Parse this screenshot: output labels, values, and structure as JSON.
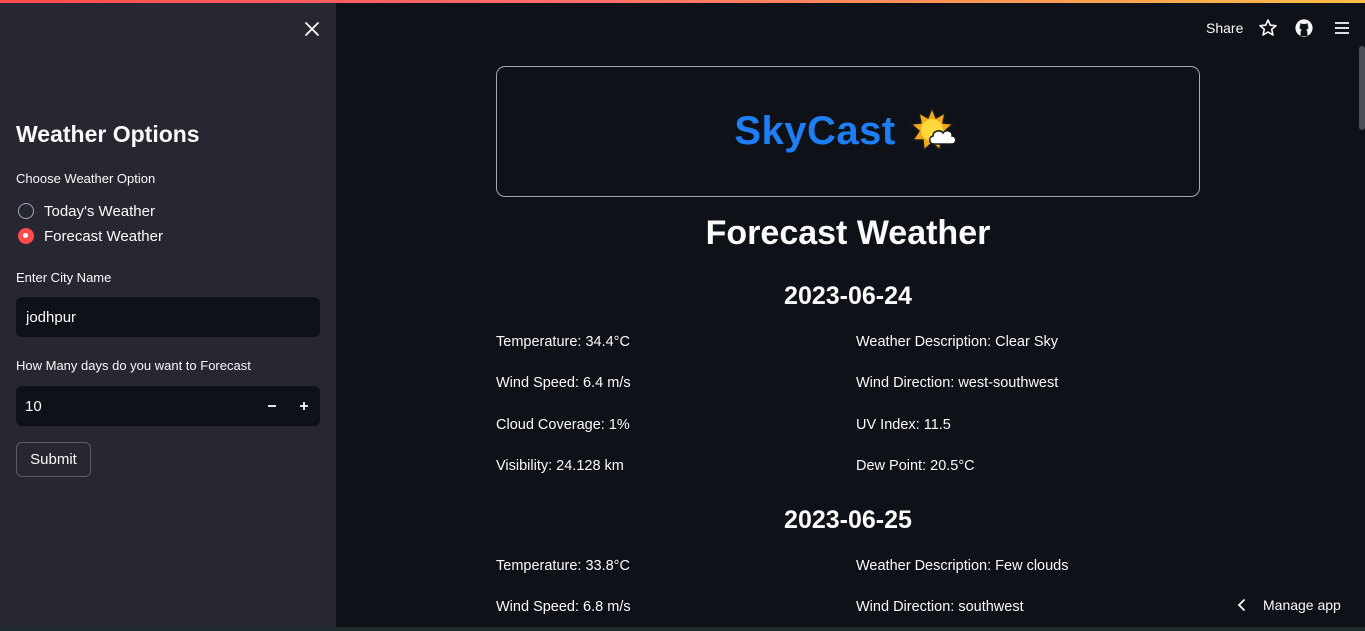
{
  "sidebar": {
    "title": "Weather Options",
    "option_label": "Choose Weather Option",
    "options": [
      {
        "label": "Today's Weather",
        "checked": false
      },
      {
        "label": "Forecast Weather",
        "checked": true
      }
    ],
    "city_label": "Enter City Name",
    "city_value": "jodhpur",
    "days_label": "How Many days do you want to Forecast",
    "days_value": "10",
    "submit_label": "Submit"
  },
  "header": {
    "share_label": "Share"
  },
  "brand": {
    "name": "SkyCast"
  },
  "main": {
    "title": "Forecast Weather",
    "days": [
      {
        "date": "2023-06-24",
        "temperature": "Temperature: 34.4°C",
        "description": "Weather Description: Clear Sky",
        "wind_speed": "Wind Speed: 6.4 m/s",
        "wind_direction": "Wind Direction: west-southwest",
        "cloud": "Cloud Coverage: 1%",
        "uv": "UV Index: 11.5",
        "visibility": "Visibility: 24.128 km",
        "dew_point": "Dew Point: 20.5°C"
      },
      {
        "date": "2023-06-25",
        "temperature": "Temperature: 33.8°C",
        "description": "Weather Description: Few clouds",
        "wind_speed": "Wind Speed: 6.8 m/s",
        "wind_direction": "Wind Direction: southwest"
      }
    ]
  },
  "footer": {
    "manage_label": "Manage app"
  },
  "colors": {
    "accent": "#ff4b4b",
    "brand": "#1e7ef3",
    "background": "#0e1117",
    "sidebar": "#262730"
  }
}
